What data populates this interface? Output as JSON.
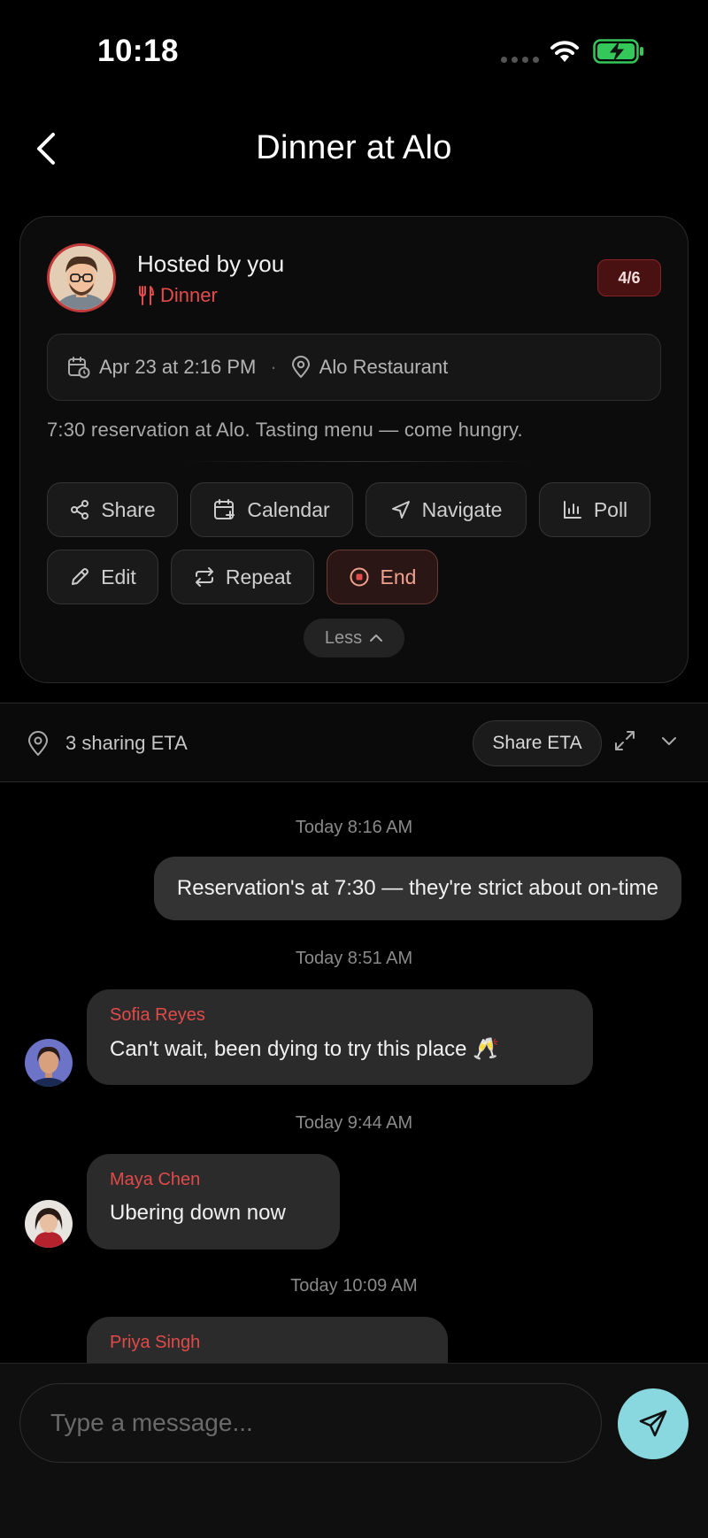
{
  "status_bar": {
    "time": "10:18"
  },
  "header": {
    "title": "Dinner at Alo"
  },
  "event_card": {
    "host_label": "Hosted by you",
    "category": "Dinner",
    "attendee_count": "4/6",
    "datetime": "Apr 23 at 2:16 PM",
    "separator": "·",
    "location": "Alo Restaurant",
    "description": "7:30 reservation at Alo. Tasting menu — come hungry.",
    "actions": {
      "share": "Share",
      "calendar": "Calendar",
      "navigate": "Navigate",
      "poll": "Poll",
      "edit": "Edit",
      "repeat": "Repeat",
      "end": "End"
    },
    "less_label": "Less"
  },
  "eta_bar": {
    "sharing_text": "3 sharing ETA",
    "share_button": "Share ETA"
  },
  "chat": {
    "messages": [
      {
        "timestamp": "Today 8:16 AM",
        "text": "Reservation's at 7:30 — they're strict about on-time"
      },
      {
        "timestamp": "Today 8:51 AM",
        "sender": "Sofia Reyes",
        "text": "Can't wait, been dying to try this place 🥂"
      },
      {
        "timestamp": "Today 9:44 AM",
        "sender": "Maya Chen",
        "text": "Ubering down now"
      },
      {
        "timestamp": "Today 10:09 AM",
        "sender": "Priya Singh",
        "text": ""
      }
    ]
  },
  "composer": {
    "placeholder": "Type a message..."
  },
  "colors": {
    "accent_red": "#e04a4a",
    "send_button": "#8ad8df",
    "battery_green": "#34c759"
  },
  "icons": [
    "back-chevron-icon",
    "wifi-icon",
    "battery-charging-icon",
    "fork-knife-icon",
    "calendar-clock-icon",
    "map-pin-icon",
    "share-icon",
    "calendar-plus-icon",
    "navigation-arrow-icon",
    "bar-chart-icon",
    "pencil-icon",
    "repeat-icon",
    "stop-circle-icon",
    "chevron-up-icon",
    "expand-icon",
    "chevron-down-icon",
    "send-icon"
  ]
}
